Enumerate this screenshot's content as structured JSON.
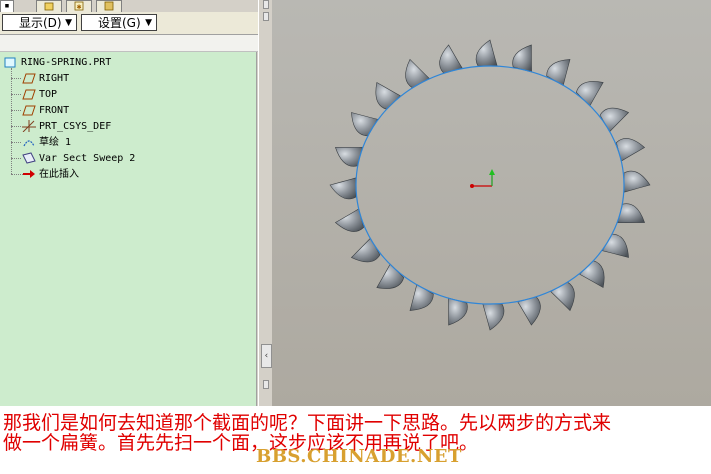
{
  "toolbar": {
    "display_label": "显示(D)",
    "settings_label": "设置(G)"
  },
  "model_tree": {
    "items": [
      {
        "label": "RING-SPRING.PRT",
        "icon": "part-icon"
      },
      {
        "label": "RIGHT",
        "icon": "datum-plane-icon"
      },
      {
        "label": "TOP",
        "icon": "datum-plane-icon"
      },
      {
        "label": "FRONT",
        "icon": "datum-plane-icon"
      },
      {
        "label": "PRT_CSYS_DEF",
        "icon": "coordinate-system-icon"
      },
      {
        "label": "草绘 1",
        "icon": "sketch-icon"
      },
      {
        "label": "Var Sect Sweep 2",
        "icon": "sweep-icon"
      },
      {
        "label": "在此插入",
        "icon": "insert-here-arrow-icon"
      }
    ]
  },
  "caption": {
    "line1": "那我们是如何去知道那个截面的呢？下面讲一下思路。先以两步的方式来",
    "line2": "做一个扁簧。首先先扫一个面，这步应该不用再说了吧。",
    "watermark": "BBS.CHINADE.NET"
  },
  "colors": {
    "tree_background": "#cdeccd",
    "caption_text": "#e00000",
    "watermark": "#d8a030",
    "viewport_background": "#b3b1aa",
    "curve": "#2f86d8",
    "surface": "#8f959c"
  }
}
